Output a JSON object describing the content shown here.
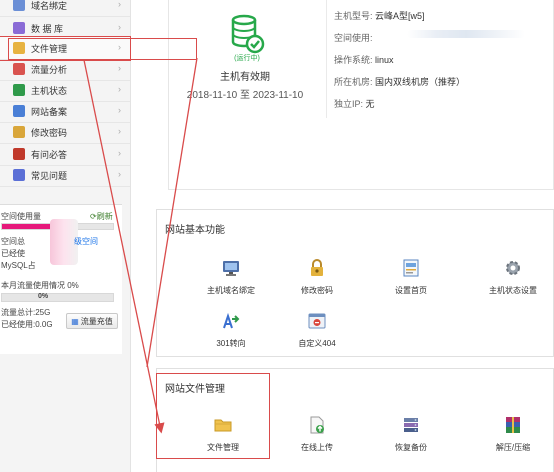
{
  "sidebar": {
    "items": [
      {
        "label": "域名绑定",
        "icon": "globe-icon",
        "color": "#6b8fd6"
      },
      {
        "label": "数 据 库",
        "icon": "database-icon",
        "color": "#8a6bd6"
      },
      {
        "label": "文件管理",
        "icon": "folder-icon",
        "color": "#e7b341"
      },
      {
        "label": "流量分析",
        "icon": "chart-icon",
        "color": "#d9534f"
      },
      {
        "label": "主机状态",
        "icon": "server-status-icon",
        "color": "#2f9a4a"
      },
      {
        "label": "网站备案",
        "icon": "record-icon",
        "color": "#4a7fd6"
      },
      {
        "label": "修改密码",
        "icon": "key-icon",
        "color": "#d9a63a"
      },
      {
        "label": "有问必答",
        "icon": "user-question-icon",
        "color": "#c0392b"
      },
      {
        "label": "常见问题",
        "icon": "help-icon",
        "color": "#5b6fd6"
      }
    ],
    "arrow": "›"
  },
  "usage": {
    "space_label": "空间使用量",
    "refresh": "刷新",
    "space_total": "空间总",
    "upgrade": "级空间",
    "space_used": "已经使",
    "mysql": "MySQL占",
    "traffic_label": "本月流量使用情况 0%",
    "traffic_percent": "0%",
    "traffic_fill": 0,
    "space_fill": 0.45,
    "traffic_total": "流量总计:25G",
    "traffic_used": "已经使用:0.0G",
    "charge": "流量充值"
  },
  "host": {
    "status": "(运行中)",
    "valid_title": "主机有效期",
    "valid_range": "2018-11-10 至 2023-11-10",
    "model_label": "主机型号:",
    "model_value": "云峰A型[w5]",
    "space_label": "空间使用:",
    "os_label": "操作系统:",
    "os_value": "linux",
    "room_label": "所在机房:",
    "room_value": "国内双线机房（推荐）",
    "ip_label": "独立IP:",
    "ip_value": "无",
    "accent": "#27a84a"
  },
  "basic": {
    "title": "网站基本功能",
    "tiles": [
      {
        "label": "主机域名绑定",
        "icon": "monitor-globe-icon"
      },
      {
        "label": "修改密码",
        "icon": "lock-key-icon"
      },
      {
        "label": "设置首页",
        "icon": "homepage-icon"
      },
      {
        "label": "主机状态设置",
        "icon": "settings-gear-icon"
      },
      {
        "label": "301转向",
        "icon": "redirect-icon"
      },
      {
        "label": "自定义404",
        "icon": "error-404-icon"
      }
    ]
  },
  "files": {
    "title": "网站文件管理",
    "tiles": [
      {
        "label": "文件管理",
        "icon": "folder-icon"
      },
      {
        "label": "在线上传",
        "icon": "upload-icon"
      },
      {
        "label": "恢复备份",
        "icon": "backup-icon"
      },
      {
        "label": "解压/压缩",
        "icon": "archive-icon"
      }
    ]
  },
  "colors": {
    "highlight": "#d94b4b",
    "arrow": "#d94b4b"
  }
}
